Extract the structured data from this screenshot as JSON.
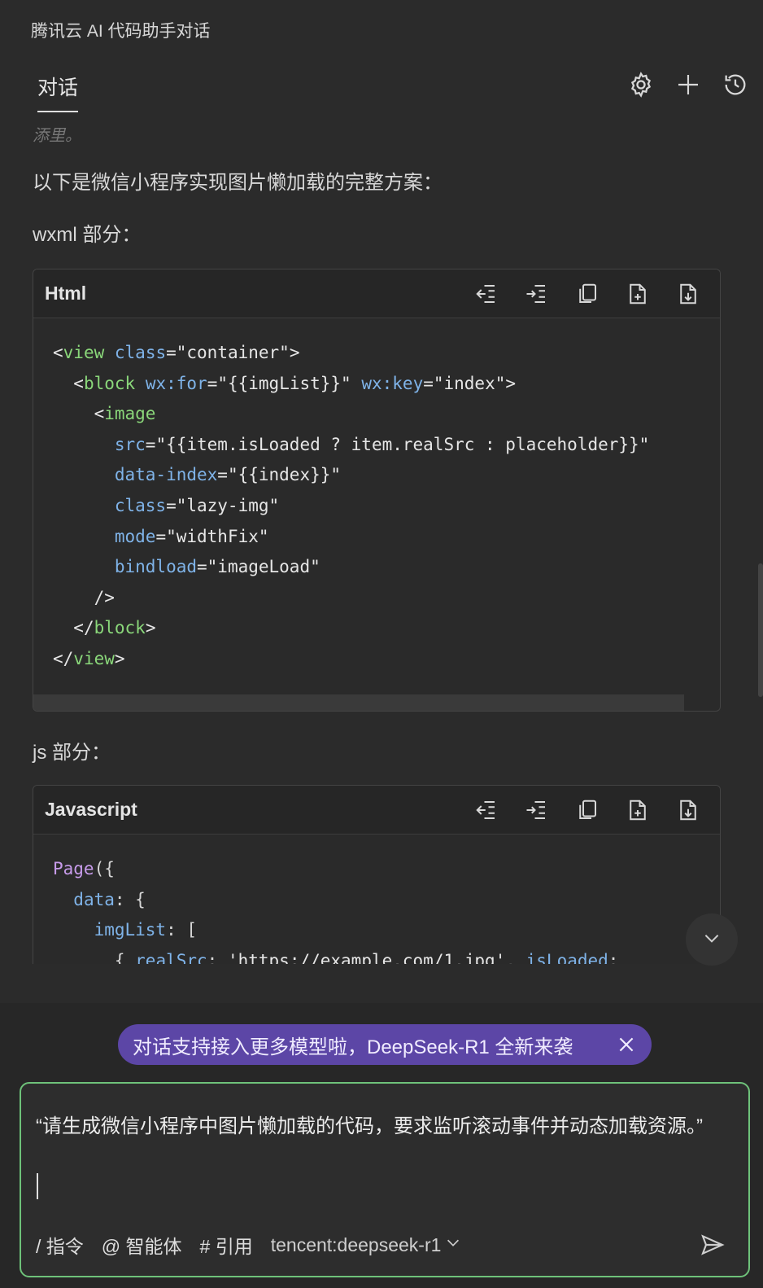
{
  "app": {
    "title": "腾讯云 AI 代码助手对话"
  },
  "tabs": {
    "active_label": "对话"
  },
  "icons": {
    "settings": "gear-icon",
    "new_chat": "plus-icon",
    "history": "history-icon"
  },
  "chat": {
    "faded_text": "添里。",
    "intro": "以下是微信小程序实现图片懒加载的完整方案：",
    "wxml_label": "wxml 部分：",
    "js_label": "js 部分：",
    "code_blocks": [
      {
        "lang": "Html",
        "lines": [
          "<view class=\"container\">",
          "  <block wx:for=\"{{imgList}}\" wx:key=\"index\">",
          "    <image",
          "      src=\"{{item.isLoaded ? item.realSrc : placeholder}}\"",
          "      data-index=\"{{index}}\"",
          "      class=\"lazy-img\"",
          "      mode=\"widthFix\"",
          "      bindload=\"imageLoad\"",
          "    />",
          "  </block>",
          "</view>"
        ]
      },
      {
        "lang": "Javascript",
        "lines": [
          "Page({",
          "  data: {",
          "    imgList: [",
          "      { realSrc: 'https://example.com/1.jpg', isLoaded:"
        ]
      }
    ]
  },
  "promo": {
    "text": "对话支持接入更多模型啦，DeepSeek-R1 全新来袭"
  },
  "input": {
    "text": "“请生成微信小程序中图片懒加载的代码，要求监听滚动事件并动态加载资源。”",
    "commands": [
      "/ 指令",
      "@ 智能体",
      "# 引用"
    ],
    "model": "tencent:deepseek-r1"
  },
  "colors": {
    "background": "#2b2b2b",
    "promo_bg": "#5c46a6",
    "input_border": "#6ec27a",
    "tag": "#8ad77a",
    "attr": "#7fb3e8",
    "keyword": "#c79bea"
  }
}
